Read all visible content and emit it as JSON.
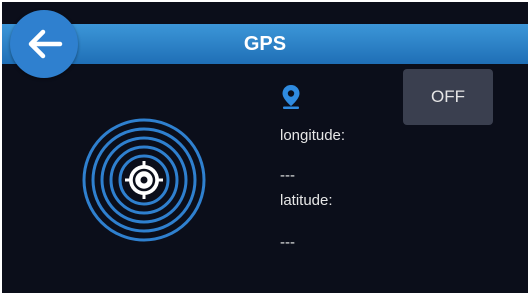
{
  "header": {
    "title": "GPS"
  },
  "back": {
    "icon": "arrow-left-icon"
  },
  "gps": {
    "pin_icon": "location-pin-icon",
    "radar_icon": "radar-target-icon",
    "longitude_label": "longitude:",
    "longitude_value": "---",
    "latitude_label": "latitude:",
    "latitude_value": "---",
    "toggle_label": "OFF"
  },
  "colors": {
    "background": "#0b0e1a",
    "header": "#2a82cc",
    "accent": "#2f80cf",
    "button": "#3a3f4f"
  }
}
